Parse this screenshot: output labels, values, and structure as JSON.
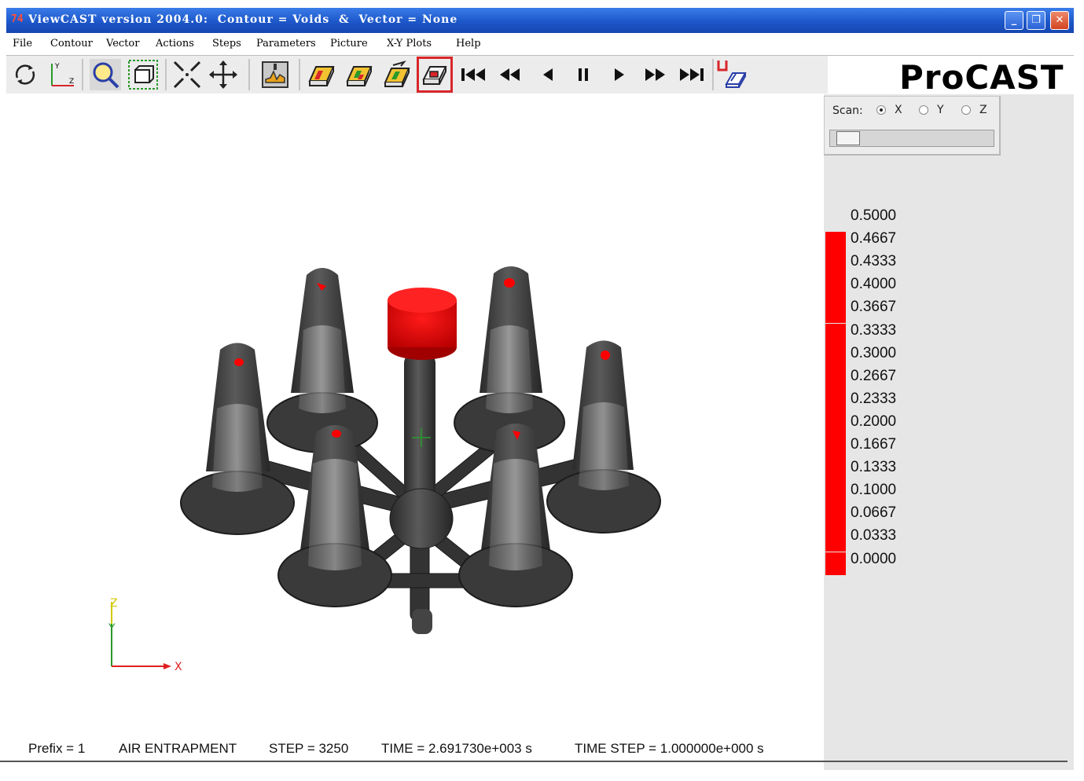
{
  "window": {
    "app_icon": "74",
    "title": "ViewCAST version 2004.0:  Contour = Voids  &  Vector = None",
    "minimize": "_",
    "restore": "❐",
    "close": "✕"
  },
  "menu": [
    "File",
    "Contour",
    "Vector",
    "Actions",
    "Steps",
    "Parameters",
    "Picture",
    "X-Y Plots",
    "Help"
  ],
  "toolbar": {
    "icons": [
      "rotate-icon",
      "axes-view-icon",
      "zoom-icon",
      "fit-box-icon",
      "shrink-icon",
      "pan-icon",
      "mesh-display-icon",
      "cut-plane-1-icon",
      "cut-plane-2-icon",
      "cut-plane-3-icon",
      "cut-plane-active-icon",
      "first-step-icon",
      "fast-rewind-icon",
      "step-back-icon",
      "pause-icon",
      "play-icon",
      "fast-forward-icon",
      "last-step-icon",
      "save-picture-icon"
    ],
    "active": "cut-plane-active-icon"
  },
  "brand": {
    "logo": "ProCAST"
  },
  "scan": {
    "label": "Scan:",
    "options": [
      "X",
      "Y",
      "Z"
    ],
    "selected": "X",
    "slider_fraction": 0.05
  },
  "legend": {
    "color": "#ff0000",
    "values": [
      "0.5000",
      "0.4667",
      "0.4333",
      "0.4000",
      "0.3667",
      "0.3333",
      "0.3000",
      "0.2667",
      "0.2333",
      "0.2000",
      "0.1667",
      "0.1333",
      "0.1000",
      "0.0667",
      "0.0333",
      "0.0000"
    ]
  },
  "axes": {
    "z": "Z",
    "y": "Y",
    "x": "X"
  },
  "status": {
    "prefix": "Prefix = 1",
    "mode": "AIR ENTRAPMENT",
    "step": "STEP = 3250",
    "time": "TIME = 2.691730e+003 s",
    "time_step": "TIME STEP = 1.000000e+000 s"
  },
  "colors": {
    "titlebar": "#1d57c9",
    "void": "#ff0000",
    "casting": "#3c3c3c"
  }
}
